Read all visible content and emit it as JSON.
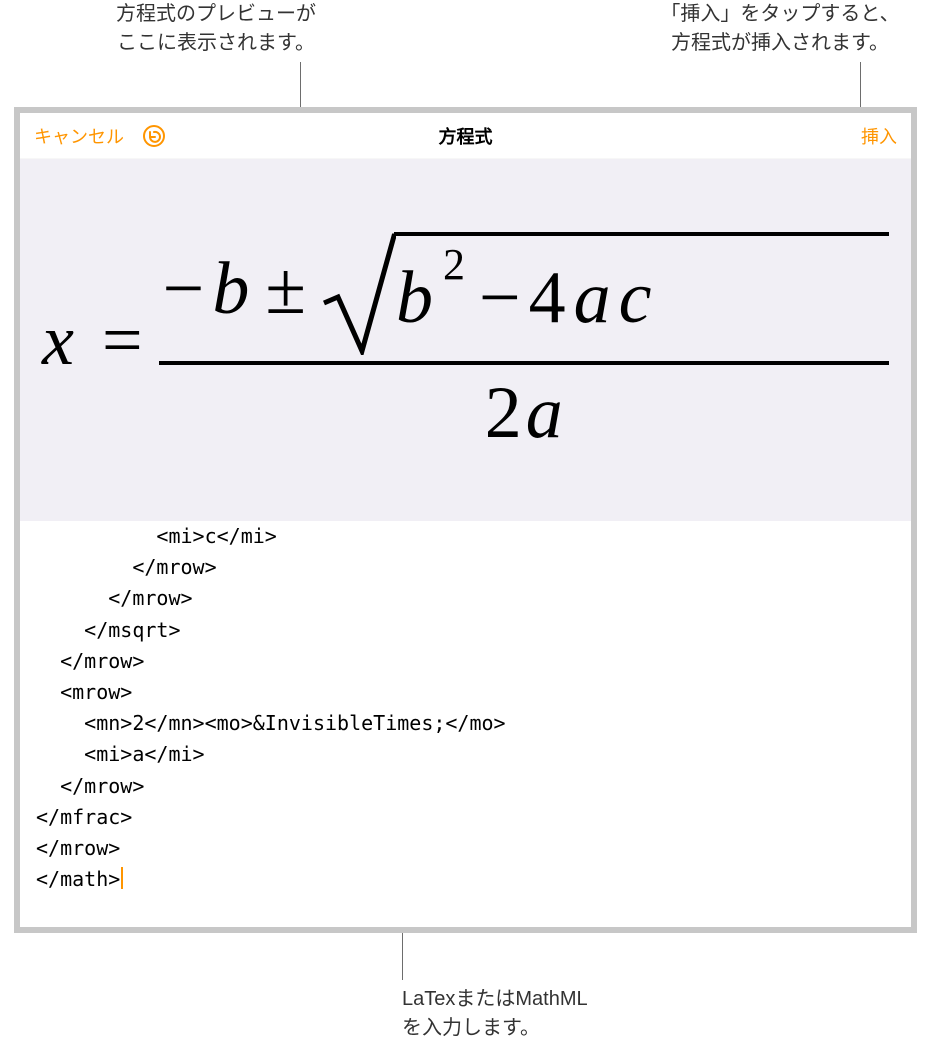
{
  "callouts": {
    "preview_here": "方程式のプレビューが\nここに表示されます。",
    "tap_insert": "「挿入」をタップすると、\n方程式が挿入されます。",
    "input_hint": "LaTexまたはMathML\nを入力します。"
  },
  "navbar": {
    "cancel": "キャンセル",
    "title": "方程式",
    "insert": "挿入",
    "undo_icon_name": "undo-icon"
  },
  "equation": {
    "x": "x",
    "equals": "=",
    "minus": "−",
    "b": "b",
    "pm": "±",
    "sq_b": "b",
    "sq_exp": "2",
    "minus2": "−",
    "four": "4",
    "a": "a",
    "c": "c",
    "den_two": "2",
    "den_a": "a"
  },
  "code_lines": [
    "          <mi>c</mi>",
    "        </mrow>",
    "      </mrow>",
    "    </msqrt>",
    "  </mrow>",
    "  <mrow>",
    "    <mn>2</mn><mo>&InvisibleTimes;</mo>",
    "    <mi>a</mi>",
    "  </mrow>",
    "</mfrac>",
    "</mrow>",
    "</math>"
  ],
  "colors": {
    "accent": "#ff9500"
  }
}
